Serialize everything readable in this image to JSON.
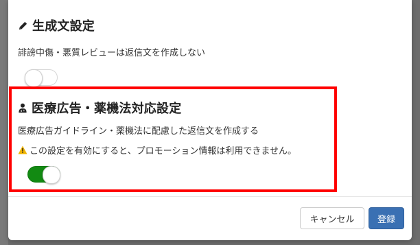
{
  "sections": [
    {
      "icon": "pencil-icon",
      "title": "生成文設定",
      "description": "誹謗中傷・悪質レビューは返信文を作成しない",
      "toggle_on": false
    },
    {
      "icon": "doctor-icon",
      "title": "医療広告・薬機法対応設定",
      "description": "医療広告ガイドライン・薬機法に配慮した返信文を作成する",
      "warning_icon": "warning-icon",
      "warning": "この設定を有効にすると、プロモーション情報は利用できません。",
      "toggle_on": true
    }
  ],
  "footer": {
    "cancel_label": "キャンセル",
    "register_label": "登録"
  },
  "colors": {
    "toggle_on": "#128a12",
    "register_button": "#3a70b3",
    "highlight_border": "#ff0000",
    "warning": "#f0b400"
  }
}
